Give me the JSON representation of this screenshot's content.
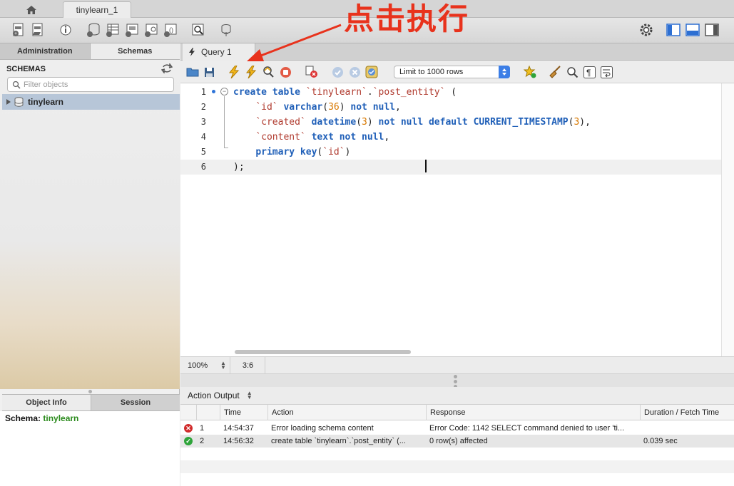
{
  "tabbar": {
    "connection_tab": "tinylearn_1"
  },
  "sidebar": {
    "tabs": [
      "Administration",
      "Schemas"
    ],
    "schemas_header": "SCHEMAS",
    "filter_placeholder": "Filter objects",
    "schema_items": [
      "tinylearn"
    ],
    "info_tabs": [
      "Object Info",
      "Session"
    ],
    "info_label": "Schema:",
    "info_value": "tinylearn"
  },
  "query": {
    "tab_label": "Query 1",
    "limit_select": "Limit to 1000 rows",
    "zoom": "100%",
    "cursor_position": "3:6"
  },
  "editor": {
    "line_numbers": [
      "1",
      "2",
      "3",
      "4",
      "5",
      "6"
    ],
    "lines": [
      [
        [
          "kw",
          "create table "
        ],
        [
          "id",
          "`tinylearn`"
        ],
        [
          "pl",
          "."
        ],
        [
          "id",
          "`post_entity`"
        ],
        [
          "pl",
          " ("
        ]
      ],
      [
        [
          "pl",
          "    "
        ],
        [
          "id",
          "`id`"
        ],
        [
          "pl",
          " "
        ],
        [
          "kw",
          "varchar"
        ],
        [
          "pl",
          "("
        ],
        [
          "num",
          "36"
        ],
        [
          "pl",
          ") "
        ],
        [
          "kw",
          "not null"
        ],
        [
          "pl",
          ","
        ]
      ],
      [
        [
          "pl",
          "    "
        ],
        [
          "id",
          "`created`"
        ],
        [
          "pl",
          " "
        ],
        [
          "kw",
          "datetime"
        ],
        [
          "pl",
          "("
        ],
        [
          "num",
          "3"
        ],
        [
          "pl",
          ") "
        ],
        [
          "kw",
          "not null default CURRENT_TIMESTAMP"
        ],
        [
          "pl",
          "("
        ],
        [
          "num",
          "3"
        ],
        [
          "pl",
          "),"
        ]
      ],
      [
        [
          "pl",
          "    "
        ],
        [
          "id",
          "`content`"
        ],
        [
          "pl",
          " "
        ],
        [
          "kw",
          "text not null"
        ],
        [
          "pl",
          ","
        ]
      ],
      [
        [
          "pl",
          "    "
        ],
        [
          "kw",
          "primary key"
        ],
        [
          "pl",
          "("
        ],
        [
          "id",
          "`id`"
        ],
        [
          "pl",
          ")"
        ]
      ],
      [
        [
          "pl",
          ");"
        ]
      ]
    ]
  },
  "output": {
    "selector_label": "Action Output",
    "columns": [
      "",
      "Time",
      "Action",
      "Response",
      "Duration / Fetch Time"
    ],
    "rows": [
      {
        "status": "error",
        "num": "1",
        "time": "14:54:37",
        "action": "Error loading schema content",
        "response": "Error Code: 1142 SELECT command denied to user 'ti...",
        "duration": ""
      },
      {
        "status": "ok",
        "num": "2",
        "time": "14:56:32",
        "action": "create table `tinylearn`.`post_entity` (...",
        "response": "0 row(s) affected",
        "duration": "0.039 sec"
      }
    ]
  },
  "annotation": {
    "text": "点击执行",
    "color": "#e8321c"
  },
  "colors": {
    "accent": "#3c7ee6",
    "keyword": "#1f5fb8",
    "identifier": "#b03a2e",
    "number": "#d87800",
    "schema_green": "#2a8a1c"
  }
}
